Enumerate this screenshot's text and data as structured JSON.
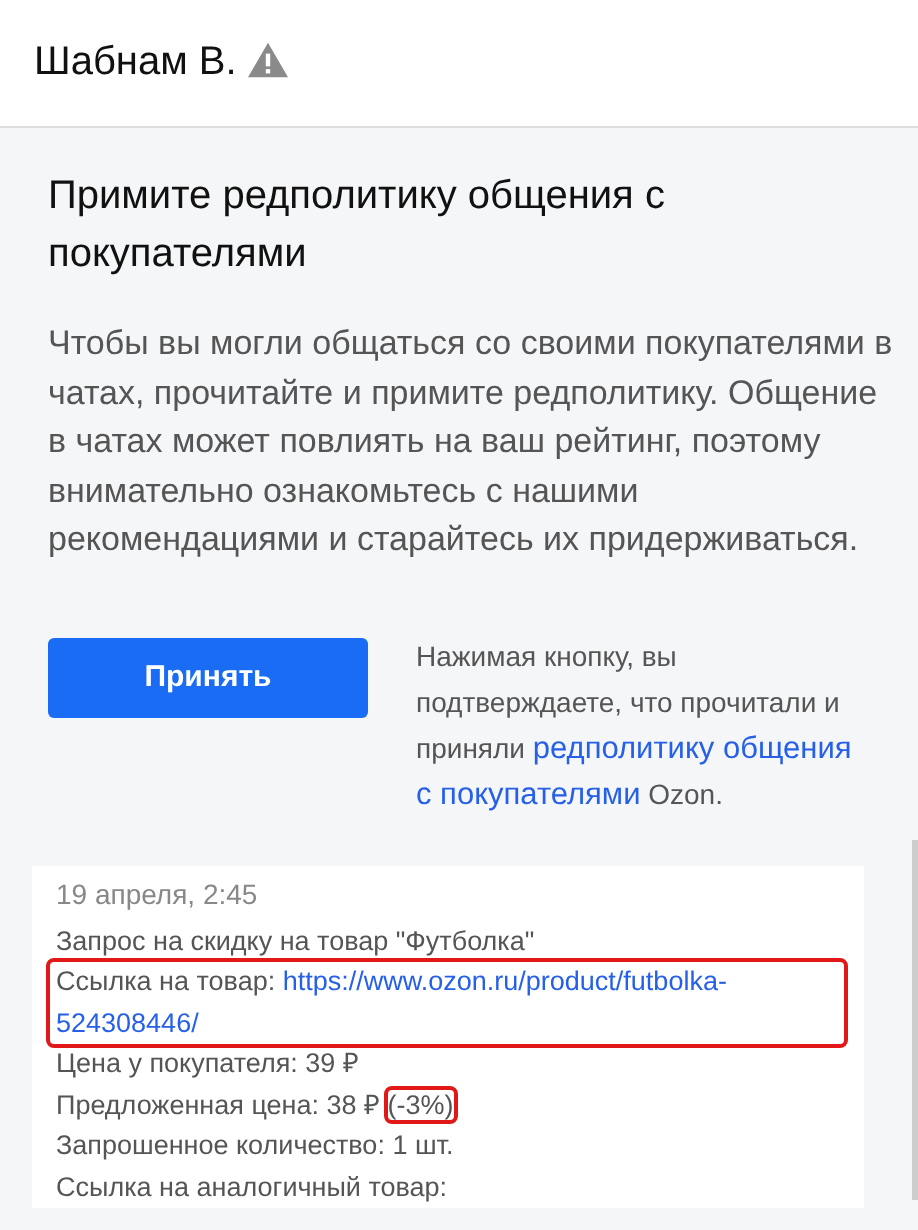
{
  "header": {
    "name": "Шабнам В.",
    "warning": true
  },
  "policy": {
    "title": "Примите редполитику общения с покупателями",
    "text": "Чтобы вы могли общаться со своими покупателями в чатах, прочитайте и примите редполитику. Общение в чатах может повлиять на ваш рейтинг, поэтому внимательно ознакомьтесь с нашими рекомендациями и старайтесь их придерживаться.",
    "button": "Принять",
    "note": [
      {
        "kind": "plain",
        "text": "Нажимая кнопку, вы подтверждаете, что прочитали и приняли "
      },
      {
        "kind": "link",
        "text": "редполитику общения"
      },
      {
        "kind": "link",
        "text": "с покупателями"
      },
      {
        "kind": "plain",
        "text": " Ozon."
      }
    ]
  },
  "message": {
    "time": "19 апреля, 2:45",
    "lines": [
      {
        "parts": [
          {
            "kind": "plain",
            "text": "Запрос на скидку на товар \"Футболка\""
          }
        ]
      },
      {
        "highlighted": true,
        "parts": [
          {
            "kind": "plain",
            "text": "Ссылка на товар: "
          },
          {
            "kind": "link",
            "text": "https://www.ozon.ru/product/futbolka-"
          },
          {
            "kind": "link",
            "text": "524308446/"
          }
        ]
      },
      {
        "parts": [
          {
            "kind": "plain",
            "text": "Цена у покупателя: 39 ₽"
          }
        ]
      },
      {
        "parts": [
          {
            "kind": "plain",
            "text": "Предложенная цена: 38 ₽ "
          },
          {
            "kind": "plain",
            "text": "(-3%)",
            "highlighted": true
          }
        ]
      },
      {
        "parts": [
          {
            "kind": "plain",
            "text": "Запрошенное количество: 1 шт."
          }
        ]
      },
      {
        "parts": [
          {
            "kind": "plain",
            "text": "Ссылка на аналогичный товар:"
          }
        ]
      }
    ]
  }
}
